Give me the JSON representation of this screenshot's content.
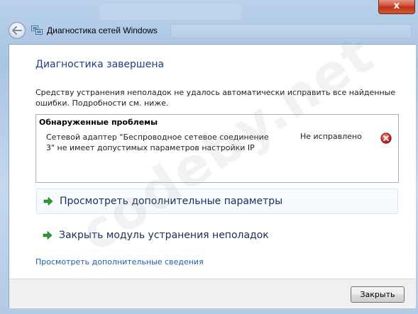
{
  "window": {
    "title": "Диагностика сетей Windows",
    "close_glyph": "x"
  },
  "main": {
    "heading": "Диагностика завершена",
    "description": "Средству устранения неполадок не удалось автоматически исправить все найденные ошибки. Подробности см. ниже.",
    "problems": {
      "title": "Обнаруженные проблемы",
      "items": [
        {
          "text": "Сетевой адаптер \"Беспроводное сетевое соединение 3\" не имеет допустимых параметров настройки IP",
          "status": "Не исправлено",
          "icon": "error-icon"
        }
      ]
    },
    "actions": [
      {
        "label": "Просмотреть дополнительные параметры",
        "icon": "green-arrow-icon"
      },
      {
        "label": "Закрыть модуль устранения неполадок",
        "icon": "green-arrow-icon"
      }
    ],
    "more_link": "Просмотреть дополнительные сведения"
  },
  "footer": {
    "close_label": "Закрыть"
  },
  "watermark": "codeby.net",
  "colors": {
    "heading": "#1f3d8f",
    "link": "#1a5fb4",
    "arrow": "#2e9a2e",
    "error": "#c62828"
  }
}
